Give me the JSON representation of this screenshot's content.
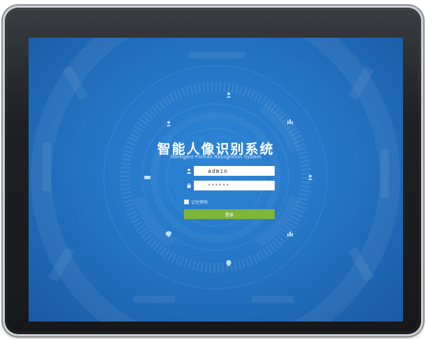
{
  "login": {
    "title": "智能人像识别系统",
    "subtitle": "Intelligent Portrait Recognition System",
    "username_value": "admin",
    "password_value": "******",
    "remember_label": "记住密码",
    "login_button": "登录"
  },
  "theme": {
    "screen_blue": "#2677c8",
    "button_green": "#7fb53b",
    "icon_blue": "#2a7ad0",
    "bezel": "#1e2023"
  },
  "icons": [
    "user-icon",
    "lock-icon",
    "person-node-icon",
    "camera-node-icon",
    "chart-node-icon",
    "shield-node-icon",
    "pin-node-icon"
  ]
}
